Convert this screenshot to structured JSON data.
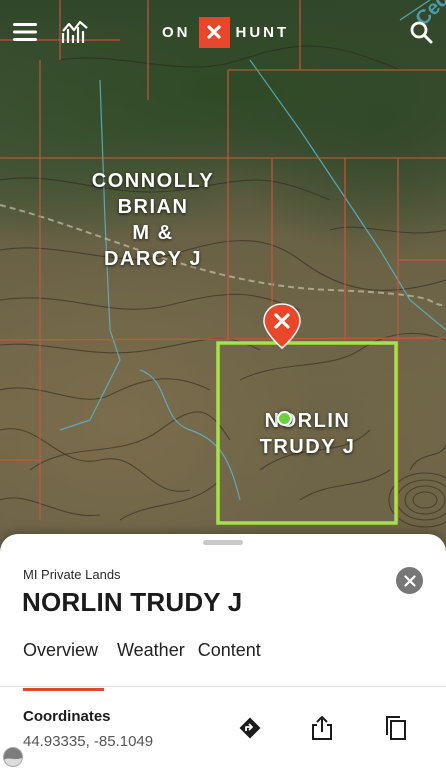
{
  "app": {
    "logo_left": "ON",
    "logo_right": "HUNT",
    "accent_color": "#e8472b"
  },
  "header": {
    "icons": [
      "menu-icon",
      "layers-icon",
      "search-icon"
    ]
  },
  "map": {
    "corner_label": "Ced",
    "parcels": [
      {
        "owner_lines": [
          "CONNOLLY",
          "BRIAN",
          "M &",
          "DARCY J"
        ]
      },
      {
        "owner_lines": [
          "NORLIN",
          "TRUDY J"
        ],
        "selected": true,
        "highlight_color": "#a6e34a"
      }
    ]
  },
  "sheet": {
    "subtitle": "MI Private Lands",
    "title": "NORLIN TRUDY J",
    "tabs": [
      {
        "label": "Overview",
        "active": true
      },
      {
        "label": "Weather",
        "active": false
      },
      {
        "label": "Content",
        "active": false
      }
    ],
    "coordinates_label": "Coordinates",
    "coordinates_value": "44.93335, -85.1049",
    "actions": [
      "directions-icon",
      "share-icon",
      "copy-icon"
    ]
  }
}
